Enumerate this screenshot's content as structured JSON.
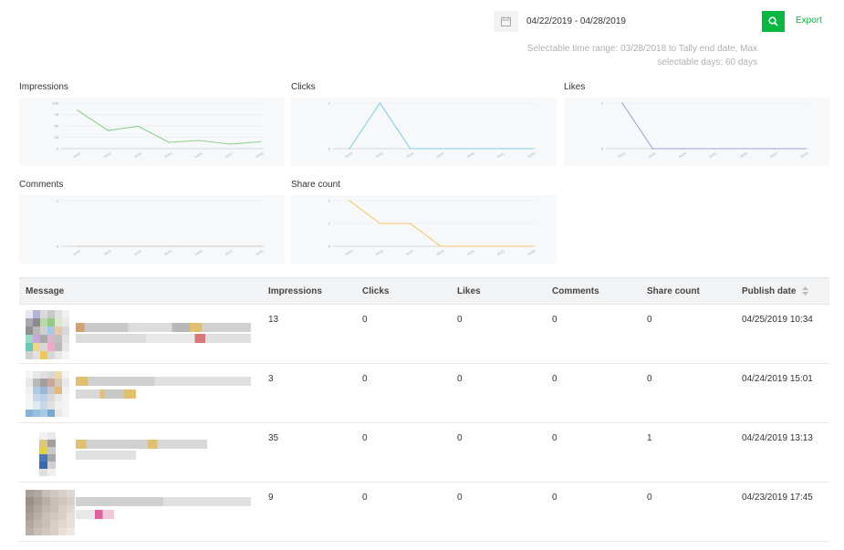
{
  "header": {
    "date_range": "04/22/2019 - 04/28/2019",
    "export_label": "Export",
    "range_note": "Selectable time range: 03/28/2018 to Tally end date, Max selectable days: 60 days",
    "icons": {
      "calendar": "calendar-icon",
      "search": "search-icon"
    },
    "accent_color": "#09b83e"
  },
  "charts": [
    {
      "key": "impressions",
      "title": "Impressions",
      "color": "#8fd18f",
      "ymax": 100,
      "yticks": [
        "0",
        "25",
        "50",
        "75",
        "100"
      ]
    },
    {
      "key": "clicks",
      "title": "Clicks",
      "color": "#7fd0e6",
      "ymax": 1,
      "yticks": [
        "0",
        "1"
      ]
    },
    {
      "key": "likes",
      "title": "Likes",
      "color": "#a7a3d6",
      "ymax": 1,
      "yticks": [
        "0",
        "1"
      ]
    },
    {
      "key": "comments",
      "title": "Comments",
      "color": "#c8c8c8",
      "ymax": 1,
      "yticks": [
        "0",
        "1"
      ]
    },
    {
      "key": "share_count",
      "title": "Share count",
      "color": "#f4c96a",
      "ymax": 2,
      "yticks": [
        "0",
        "1",
        "2"
      ]
    }
  ],
  "chart_data": [
    {
      "type": "line",
      "title": "Impressions",
      "x": [
        "04/22",
        "04/23",
        "04/24",
        "04/25",
        "04/26",
        "04/27",
        "04/28"
      ],
      "series": [
        {
          "values": [
            84,
            40,
            49,
            14,
            18,
            10,
            15
          ]
        }
      ],
      "ylim": [
        0,
        100
      ]
    },
    {
      "type": "line",
      "title": "Clicks",
      "x": [
        "04/22",
        "04/23",
        "04/24",
        "04/25",
        "04/26",
        "04/27",
        "04/28"
      ],
      "series": [
        {
          "values": [
            0,
            1,
            0,
            0,
            0,
            0,
            0
          ]
        }
      ],
      "ylim": [
        0,
        1
      ]
    },
    {
      "type": "line",
      "title": "Likes",
      "x": [
        "04/22",
        "04/23",
        "04/24",
        "04/25",
        "04/26",
        "04/27",
        "04/28"
      ],
      "series": [
        {
          "values": [
            1,
            0,
            0,
            0,
            0,
            0,
            0
          ]
        }
      ],
      "ylim": [
        0,
        1
      ]
    },
    {
      "type": "line",
      "title": "Comments",
      "x": [
        "04/22",
        "04/23",
        "04/24",
        "04/25",
        "04/26",
        "04/27",
        "04/28"
      ],
      "series": [
        {
          "values": [
            0,
            0,
            0,
            0,
            0,
            0,
            0
          ]
        }
      ],
      "ylim": [
        0,
        1
      ]
    },
    {
      "type": "line",
      "title": "Share count",
      "x": [
        "04/22",
        "04/23",
        "04/24",
        "04/25",
        "04/26",
        "04/27",
        "04/28"
      ],
      "series": [
        {
          "values": [
            2,
            1,
            1,
            0,
            0,
            0,
            0
          ]
        }
      ],
      "ylim": [
        0,
        2
      ]
    }
  ],
  "table": {
    "columns": [
      "Message",
      "Impressions",
      "Clicks",
      "Likes",
      "Comments",
      "Share count",
      "Publish date"
    ],
    "rows": [
      {
        "impressions": "13",
        "clicks": "0",
        "likes": "0",
        "comments": "0",
        "share_count": "0",
        "publish_date": "04/25/2019 10:34"
      },
      {
        "impressions": "3",
        "clicks": "0",
        "likes": "0",
        "comments": "0",
        "share_count": "0",
        "publish_date": "04/24/2019 15:01"
      },
      {
        "impressions": "35",
        "clicks": "0",
        "likes": "0",
        "comments": "0",
        "share_count": "1",
        "publish_date": "04/24/2019 13:13"
      },
      {
        "impressions": "9",
        "clicks": "0",
        "likes": "0",
        "comments": "0",
        "share_count": "0",
        "publish_date": "04/23/2019 17:45"
      }
    ]
  }
}
